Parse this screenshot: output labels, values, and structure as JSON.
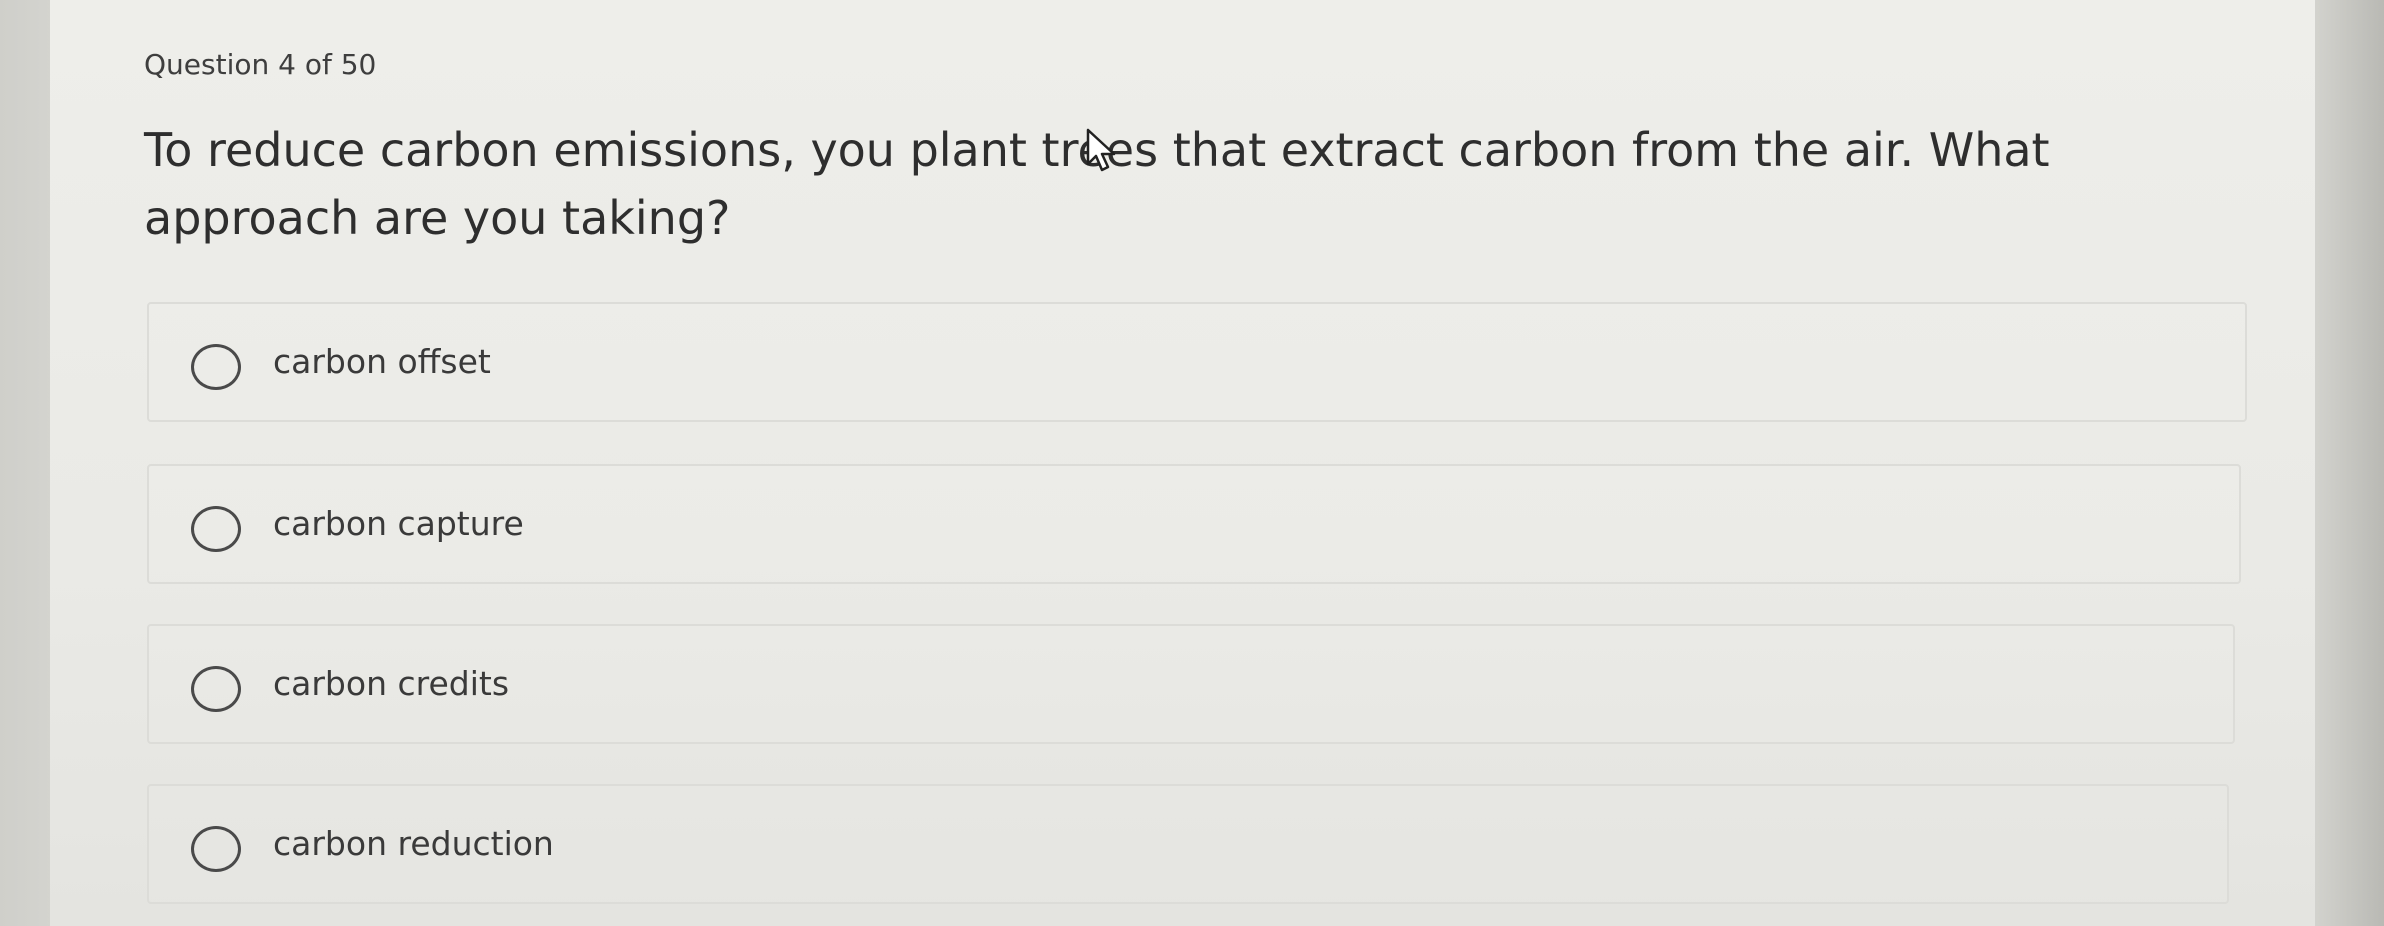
{
  "quiz": {
    "counter": "Question 4 of 50",
    "question": "To reduce carbon emissions, you plant trees that extract carbon from the air. What approach are you taking?",
    "options": [
      {
        "label": "carbon offset"
      },
      {
        "label": "carbon capture"
      },
      {
        "label": "carbon credits"
      },
      {
        "label": "carbon reduction"
      }
    ]
  },
  "icons": {
    "cursor": "arrow-cursor-icon",
    "radio": "radio-button-icon"
  }
}
